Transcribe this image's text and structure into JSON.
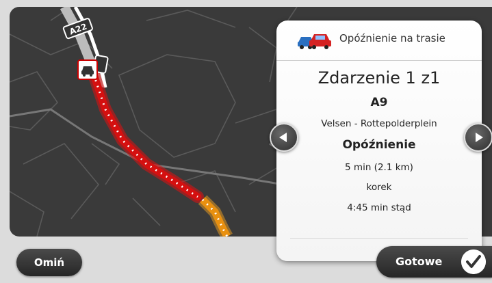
{
  "map": {
    "road_label": "A22",
    "incident_icon": "traffic-jam-icon"
  },
  "panel": {
    "title": "Opóźnienie na trasie",
    "header_icon": "traffic-cars-icon",
    "incident": "Zdarzenie 1 z1",
    "road": "A9",
    "segment": "Velsen - Rottepolderplein",
    "type": "Opóźnienie",
    "delay": "5 min (2.1 km)",
    "cause": "korek",
    "distance": "4:45 min stąd"
  },
  "buttons": {
    "skip": "Omiń",
    "done": "Gotowe"
  },
  "colors": {
    "jam": "#e01010",
    "slow": "#f0a020",
    "accent": "#333333"
  }
}
